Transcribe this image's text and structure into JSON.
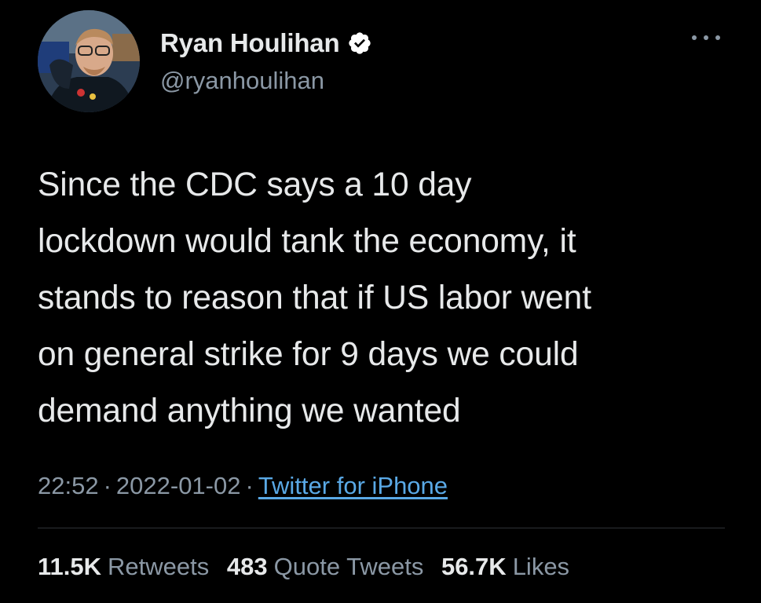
{
  "author": {
    "display_name": "Ryan Houlihan",
    "handle": "@ryanhoulihan",
    "verified": true,
    "avatar_icon": "profile-photo",
    "verified_icon": "verified-badge-icon"
  },
  "menu": {
    "icon": "more-options-icon"
  },
  "tweet": {
    "lines": [
      "Since the CDC says a 10 day",
      "lockdown would tank the economy, it",
      "stands to reason that if US labor went",
      "on general strike for 9 days we could",
      "demand anything we wanted"
    ]
  },
  "meta": {
    "time": "22:52",
    "separator": "·",
    "date": "2022-01-02",
    "source": "Twitter for iPhone"
  },
  "stats": {
    "retweets": {
      "count": "11.5K",
      "label": "Retweets"
    },
    "quote_tweets": {
      "count": "483",
      "label": "Quote Tweets"
    },
    "likes": {
      "count": "56.7K",
      "label": "Likes"
    }
  },
  "colors": {
    "background": "#000000",
    "primary_text": "#e7e9ea",
    "secondary_text": "#8b98a5",
    "link": "#5aa9e6",
    "verified_badge": "#ffffff",
    "divider": "#2f3336"
  }
}
